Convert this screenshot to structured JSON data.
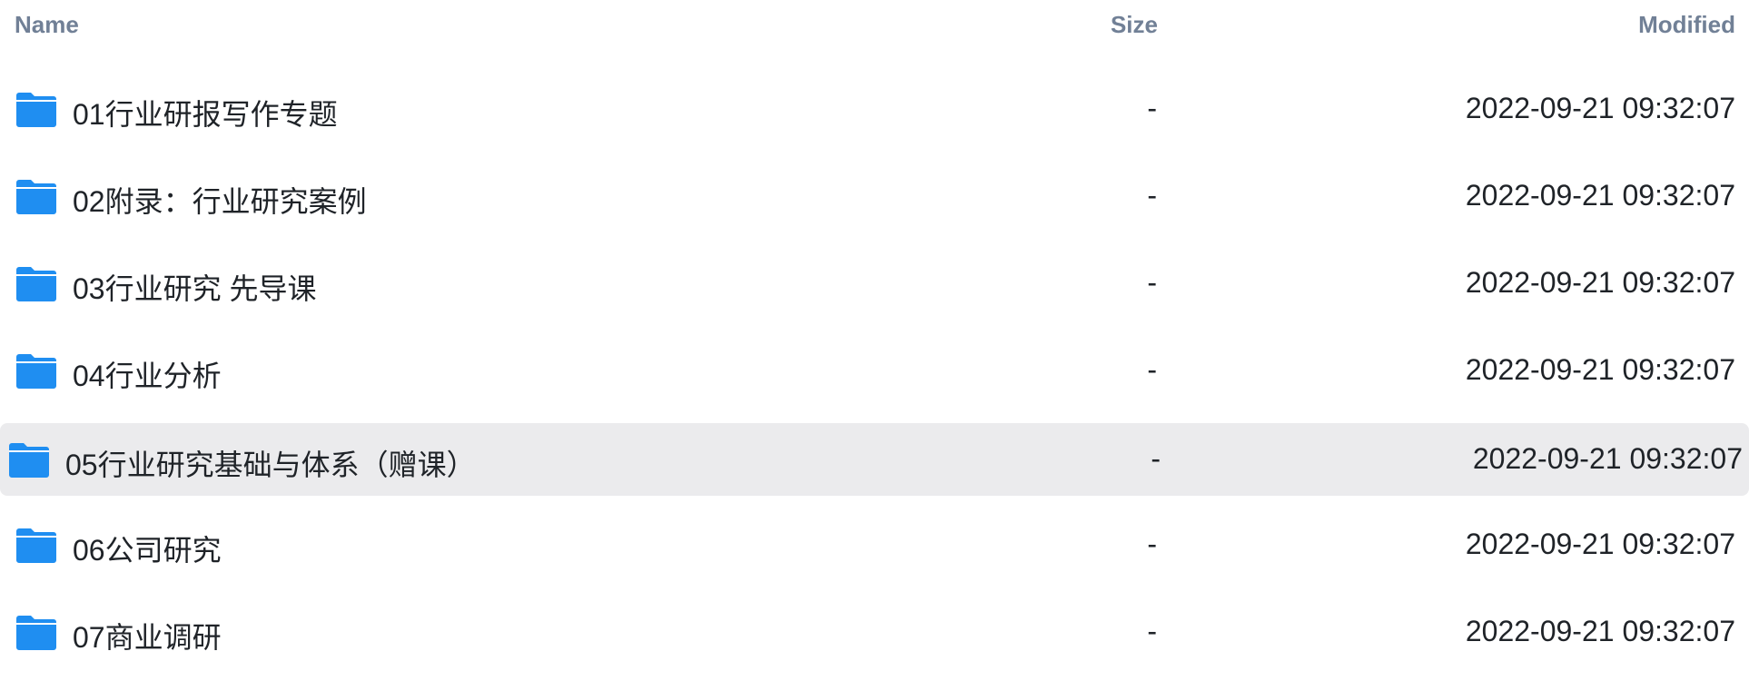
{
  "columns": {
    "name": "Name",
    "size": "Size",
    "modified": "Modified"
  },
  "folder_icon_color": "#1f8ef1",
  "selected_row_color": "#ebebed",
  "rows": [
    {
      "icon": "folder-icon",
      "name": "01行业研报写作专题",
      "size": "-",
      "modified": "2022-09-21 09:32:07"
    },
    {
      "icon": "folder-icon",
      "name": "02附录：行业研究案例",
      "size": "-",
      "modified": "2022-09-21 09:32:07"
    },
    {
      "icon": "folder-icon",
      "name": "03行业研究 先导课",
      "size": "-",
      "modified": "2022-09-21 09:32:07"
    },
    {
      "icon": "folder-icon",
      "name": "04行业分析",
      "size": "-",
      "modified": "2022-09-21 09:32:07"
    },
    {
      "icon": "folder-icon",
      "name": "05行业研究基础与体系（赠课）",
      "size": "-",
      "modified": "2022-09-21 09:32:07",
      "selected": true
    },
    {
      "icon": "folder-icon",
      "name": "06公司研究",
      "size": "-",
      "modified": "2022-09-21 09:32:07"
    },
    {
      "icon": "folder-icon",
      "name": "07商业调研",
      "size": "-",
      "modified": "2022-09-21 09:32:07"
    }
  ]
}
